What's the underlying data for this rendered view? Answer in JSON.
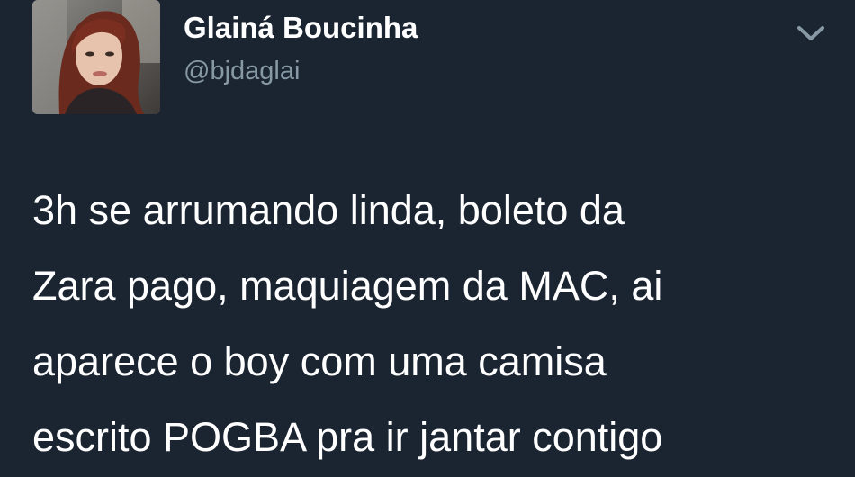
{
  "tweet": {
    "author": {
      "display_name": "Glainá Boucinha",
      "handle": "@bjdaglai",
      "avatar_icon": "user-profile-photo"
    },
    "menu_icon": "chevron-down-icon",
    "text_lines": [
      "3h se arrumando linda, boleto da",
      "Zara pago, maquiagem da MAC, ai",
      "aparece o boy com uma camisa",
      "escrito POGBA pra ir jantar contigo"
    ]
  },
  "colors": {
    "background": "#1b2532",
    "text_primary": "#ffffff",
    "text_secondary": "#8899a6",
    "icon": "#8899a6"
  }
}
